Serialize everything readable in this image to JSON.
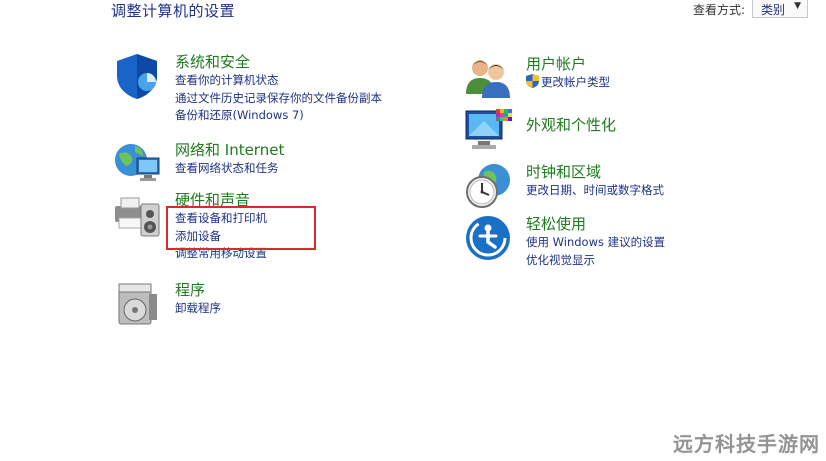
{
  "header": {
    "title": "调整计算机的设置",
    "view_by_label": "查看方式:",
    "view_by_value": "类别"
  },
  "left_column": [
    {
      "title": "系统和安全",
      "icon": "shield-icon",
      "links": [
        "查看你的计算机状态",
        "通过文件历史记录保存你的文件备份副本",
        "备份和还原(Windows 7)"
      ]
    },
    {
      "title": "网络和 Internet",
      "icon": "network-globe-icon",
      "links": [
        "查看网络状态和任务"
      ]
    },
    {
      "title": "硬件和声音",
      "icon": "printer-speaker-icon",
      "links": [
        "查看设备和打印机",
        "添加设备",
        "调整常用移动设置"
      ]
    },
    {
      "title": "程序",
      "icon": "programs-disc-icon",
      "links": [
        "卸载程序"
      ]
    }
  ],
  "right_column": [
    {
      "title": "用户帐户",
      "icon": "users-icon",
      "links": [
        "更改帐户类型"
      ]
    },
    {
      "title": "外观和个性化",
      "icon": "monitor-palette-icon",
      "links": []
    },
    {
      "title": "时钟和区域",
      "icon": "clock-globe-icon",
      "links": [
        "更改日期、时间或数字格式"
      ]
    },
    {
      "title": "轻松使用",
      "icon": "ease-of-access-icon",
      "links": [
        "使用 Windows 建议的设置",
        "优化视觉显示"
      ]
    }
  ],
  "colors": {
    "title_green": "#1e7b1e",
    "link_blue": "#1e3287",
    "highlight_red": "#d92b2b"
  },
  "watermark": "远方科技手游网"
}
